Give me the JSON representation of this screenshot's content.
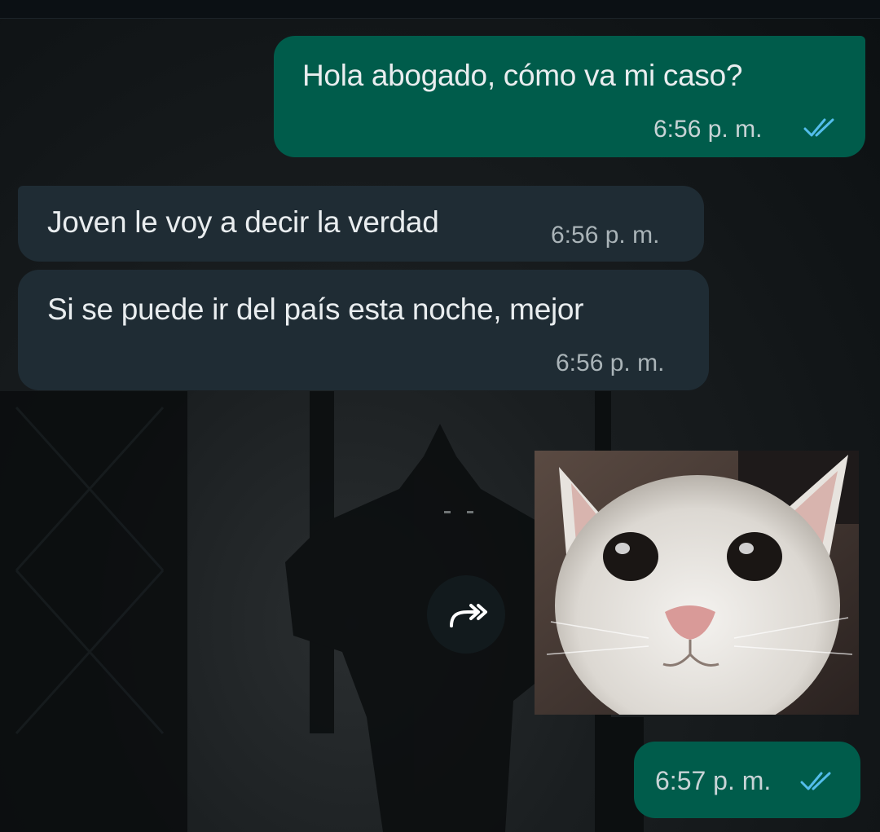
{
  "chat": {
    "messages": [
      {
        "direction": "outgoing",
        "text": "Hola abogado, cómo va mi caso?",
        "time": "6:56 p. m.",
        "status": "read"
      },
      {
        "direction": "incoming",
        "text": "Joven le voy a decir la verdad",
        "time": "6:56 p. m."
      },
      {
        "direction": "incoming",
        "text": "Si se puede ir del país esta noche, mejor",
        "time": "6:56 p. m."
      },
      {
        "direction": "outgoing",
        "type": "sticker",
        "sticker_icon": "crying-cat-sticker",
        "time": "6:57 p. m.",
        "status": "read"
      }
    ],
    "forward_icon": "forward-icon"
  },
  "colors": {
    "outgoing_bubble": "#005c4b",
    "incoming_bubble": "#1f2c34",
    "read_ticks": "#53bdeb",
    "background": "#121618"
  }
}
